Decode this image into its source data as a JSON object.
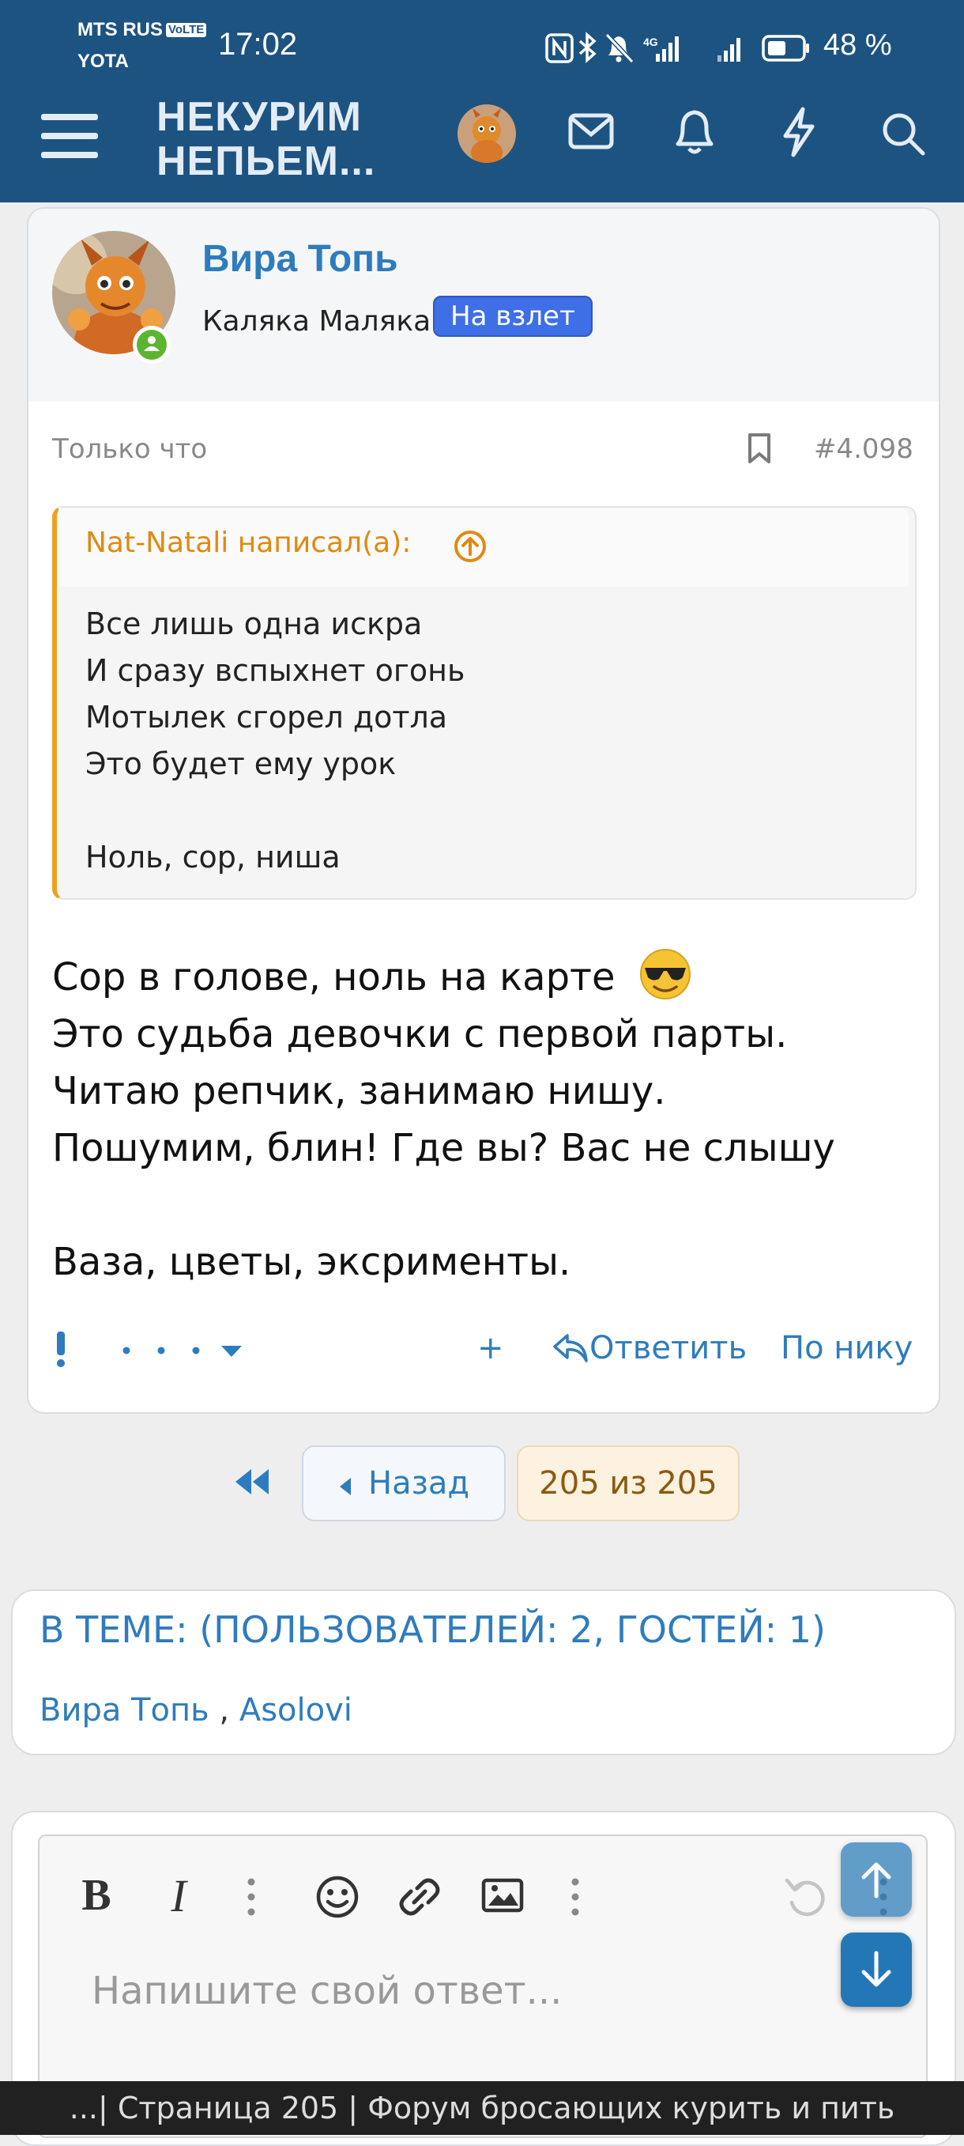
{
  "status_bar": {
    "carrier1": "MTS RUS",
    "volte": "VoLTE",
    "carrier2": "YOTA",
    "time": "17:02",
    "battery": "48 %"
  },
  "header": {
    "logo_line1": "НЕКУРИМ",
    "logo_line2": "НЕПЬЕМ..."
  },
  "post": {
    "author": "Вира Топь",
    "user_title": "Каляка Маляка",
    "badge": "На взлет",
    "time": "Только что",
    "number": "#4.098",
    "quote": {
      "author_line": "Nat-Natali написал(а):",
      "lines": [
        "Все лишь одна искра",
        "И сразу вспыхнет огонь",
        "Мотылек сгорел дотла",
        "Это будет ему урок",
        "",
        "Ноль, сор, ниша"
      ]
    },
    "body_lines": [
      "Сор в голове, ноль на карте",
      "Это судьба девочки с первой парты.",
      "Читаю репчик, занимаю нишу.",
      "Пошумим, блин! Где вы? Вас не слышу",
      "",
      "Ваза, цветы, эксрименты."
    ],
    "actions": {
      "plus": "+",
      "reply": "Ответить",
      "by_nick": "По нику"
    }
  },
  "pagination": {
    "back": "Назад",
    "current": "205 из 205"
  },
  "online": {
    "title": "В ТЕМЕ: (ПОЛЬЗОВАТЕЛЕЙ: 2, ГОСТЕЙ: 1)",
    "user1": "Вира Топь",
    "separator": " , ",
    "user2": "Asolovi"
  },
  "editor": {
    "bold": "B",
    "italic": "I",
    "placeholder": "Напишите свой ответ..."
  },
  "footer": {
    "title": "...| Страница 205 | Форум бросающих курить и пить"
  },
  "colors": {
    "header_bg": "#1d5381",
    "accent": "#2e7cbd",
    "badge": "#3f6fe6",
    "quote_border": "#f0a020"
  }
}
